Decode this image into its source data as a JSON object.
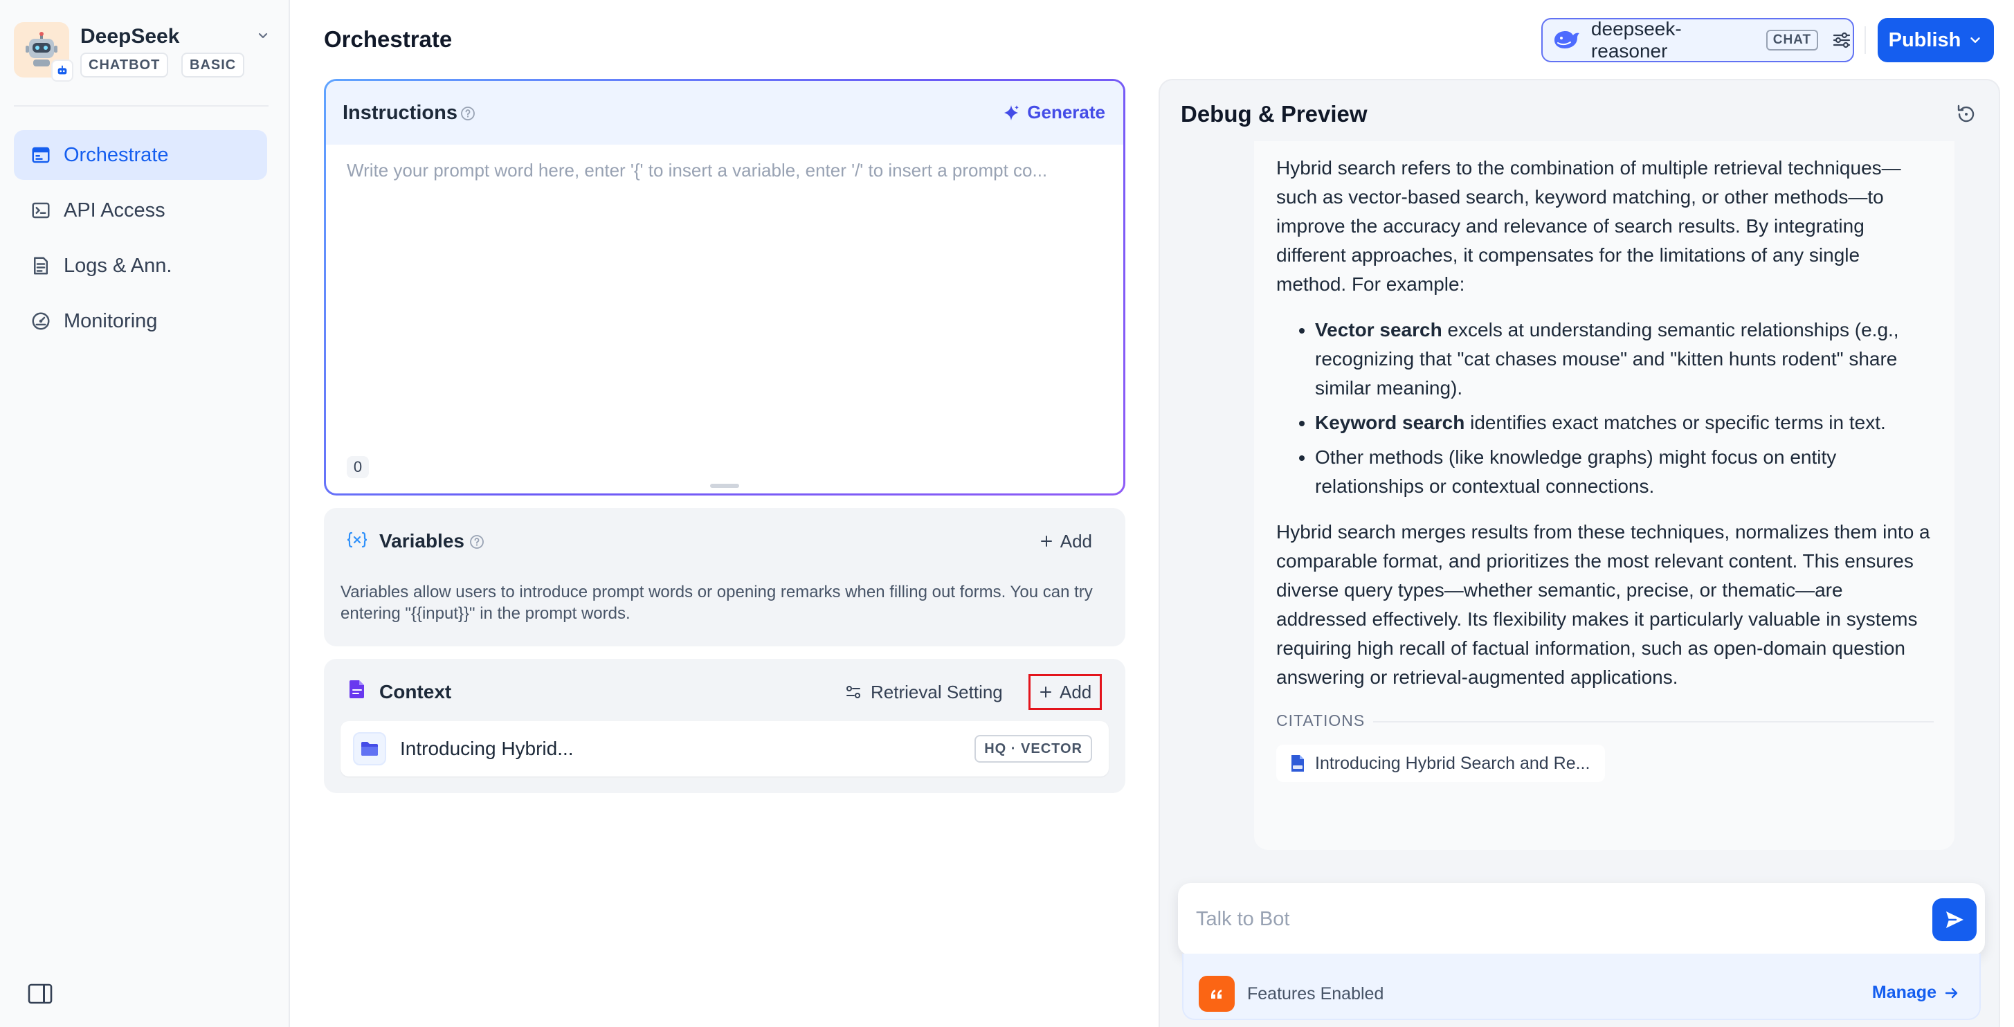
{
  "app": {
    "name": "DeepSeek",
    "tags": [
      "CHATBOT",
      "BASIC"
    ]
  },
  "sidebar": {
    "items": [
      {
        "label": "Orchestrate",
        "icon": "layout-icon",
        "active": true
      },
      {
        "label": "API Access",
        "icon": "terminal-icon",
        "active": false
      },
      {
        "label": "Logs & Ann.",
        "icon": "file-list-icon",
        "active": false
      },
      {
        "label": "Monitoring",
        "icon": "dashboard-gauge-icon",
        "active": false
      }
    ]
  },
  "header": {
    "title": "Orchestrate",
    "model": {
      "name": "deepseek-reasoner",
      "mode": "CHAT"
    },
    "publish_label": "Publish"
  },
  "instructions": {
    "title": "Instructions",
    "generate_label": "Generate",
    "placeholder": "Write your prompt word here, enter '{' to insert a variable, enter '/' to insert a prompt co...",
    "char_count": "0"
  },
  "variables": {
    "title": "Variables",
    "add_label": "Add",
    "description": "Variables allow users to introduce prompt words or opening remarks when filling out forms. You can try entering \"{{input}}\" in the prompt words."
  },
  "context": {
    "title": "Context",
    "retrieval_label": "Retrieval Setting",
    "add_label": "Add",
    "datasets": [
      {
        "name": "Introducing Hybrid...",
        "badge": "HQ · VECTOR"
      }
    ]
  },
  "debug": {
    "title": "Debug & Preview",
    "answer": {
      "intro": "Hybrid search refers to the combination of multiple retrieval techniques—such as vector-based search, keyword matching, or other methods—to improve the accuracy and relevance of search results. By integrating different approaches, it compensates for the limitations of any single method. For example:",
      "bullets": [
        {
          "bold": "Vector search",
          "text": " excels at understanding semantic relationships (e.g., recognizing that \"cat chases mouse\" and \"kitten hunts rodent\" share similar meaning)."
        },
        {
          "bold": "Keyword search",
          "text": " identifies exact matches or specific terms in text."
        },
        {
          "bold": "",
          "text": "Other methods (like knowledge graphs) might focus on entity relationships or contextual connections."
        }
      ],
      "conclusion": "Hybrid search merges results from these techniques, normalizes them into a comparable format, and prioritizes the most relevant content. This ensures diverse query types—whether semantic, precise, or thematic—are addressed effectively. Its flexibility makes it particularly valuable in systems requiring high recall of factual information, such as open-domain question answering or retrieval-augmented applications."
    },
    "citations_label": "CITATIONS",
    "citation": "Introducing Hybrid Search and Re...",
    "chat_placeholder": "Talk to Bot",
    "features_label": "Features Enabled",
    "manage_label": "Manage"
  },
  "colors": {
    "accent": "#155eef",
    "highlight_border": "#e3141c",
    "feature_icon": "#fb6514"
  }
}
